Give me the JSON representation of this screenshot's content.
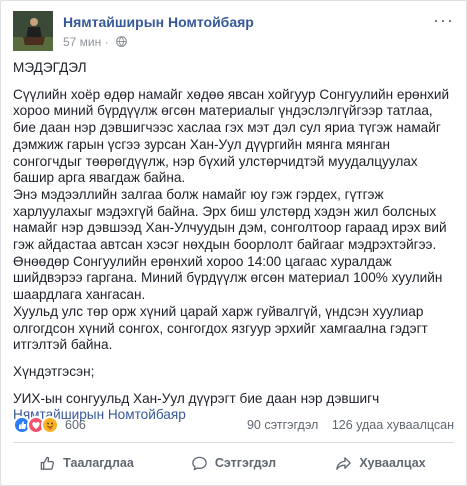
{
  "post": {
    "author": "Нямтайширын Номтойбаяр",
    "time": "57 мин",
    "privacy_icon": "globe-icon",
    "more_icon": "more-options-icon",
    "paragraphs": [
      "МЭДЭГДЭЛ",
      "Сүүлийн хоёр өдөр намайг хөдөө явсан хойгуур Сонгуулийн ерөнхий хороо миний бүрдүүлж өгсөн материалыг үндэслэлгүйгээр татлаа, бие даан нэр дэвшигчээс хаслаа гэх мэт дэл сул яриа түгэж намайг дэмжиж гарын үсгээ зурсан Хан-Уул дүүргийн мянга мянган сонгогчдыг төөрөгдүүлж, нэр бүхий улстөрчидтэй муудалцуулах башир арга явагдаж байна.",
      "Энэ мэдээллийн залгаа болж намайг юу гэж гэрдех, гүтгэж харлуулахыг мэдэхгүй байна. Эрх биш улстөрд хэдэн жил болсных намайг нэр дэвшээд Хан-Улчуудын дэм, сонголтоор гараад ирэх вий гэж айдастаа автсан хэсэг нөхдын боорлолт байгааг мэдрэхтэйгээ.",
      "Өнөөдөр Сонгуулийн ерөнхий хороо 14:00 цагаас хуралдаж шийдвэрээ гаргана. Миний бүрдүүлж өгсөн материал 100% хуулийн шаардлага хангасан.",
      "Хуульд улс төр орж хүний царай харж гуйвалгүй, үндсэн хуулиар олгогдсон хүний сонгох, сонгогдох язгуур эрхийг хамгаална гэдэгт итгэлтэй байна.",
      "Хүндэтгэсэн;",
      "УИХ-ын сонгуульд Хан-Уул дүүрэгт бие даан нэр дэвшигч"
    ],
    "signature": "Нямтайширын Номтойбаяр"
  },
  "stats": {
    "reaction_icons": [
      "like-icon",
      "love-icon",
      "care-icon"
    ],
    "reaction_count": "606",
    "comments": "90 сэтгэгдэл",
    "shares": "126 удаа хуваалцсан"
  },
  "actions": {
    "like": "Таалагдлаа",
    "comment": "Сэтгэгдэл",
    "share": "Хуваалцах"
  },
  "colors": {
    "link": "#365899",
    "text": "#1d2129",
    "muted": "#606770",
    "like": "#2e7bf6",
    "love": "#f2526e",
    "care": "#f7b125"
  }
}
